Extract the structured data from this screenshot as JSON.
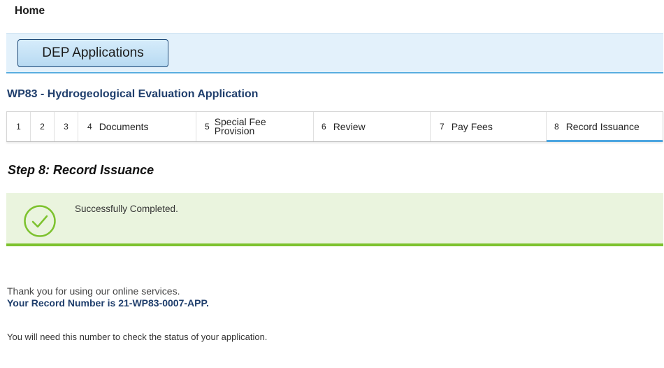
{
  "nav": {
    "home_label": "Home"
  },
  "module": {
    "button_label": "DEP Applications"
  },
  "application": {
    "title": "WP83 - Hydrogeological Evaluation Application"
  },
  "steps": [
    {
      "num": "1",
      "label": ""
    },
    {
      "num": "2",
      "label": ""
    },
    {
      "num": "3",
      "label": ""
    },
    {
      "num": "4",
      "label": "Documents"
    },
    {
      "num": "5",
      "label_line1": "Special Fee",
      "label_line2": "Provision"
    },
    {
      "num": "6",
      "label": "Review"
    },
    {
      "num": "7",
      "label": "Pay Fees"
    },
    {
      "num": "8",
      "label": "Record Issuance",
      "active": true
    }
  ],
  "step_heading": {
    "prefix": "Step 8",
    "separator": ":",
    "title": "Record Issuance"
  },
  "status": {
    "message": "Successfully Completed.",
    "icon": "check-circle-icon",
    "color": "#7dc22e"
  },
  "confirmation": {
    "thanks": "Thank you for using our online services.",
    "record_number_text": "Your Record Number is 21-WP83-0007-APP.",
    "note": "You will need this number to check the status of your application."
  },
  "colors": {
    "accent": "#4da6e0",
    "title": "#1f3e6c",
    "success_bg": "#eaf4de",
    "success_border": "#7dc22e"
  }
}
